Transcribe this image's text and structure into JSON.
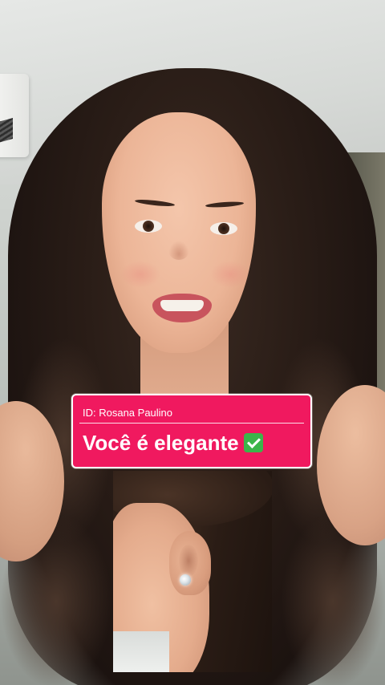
{
  "caption": {
    "id_label": "ID: Rosana Paulino",
    "headline": "Você é elegante",
    "check_icon": "check-mark-button-icon",
    "background_color": "#f0195f",
    "border_color": "#ffffff"
  },
  "inset": {
    "subject": "ear-with-stud-earring"
  }
}
